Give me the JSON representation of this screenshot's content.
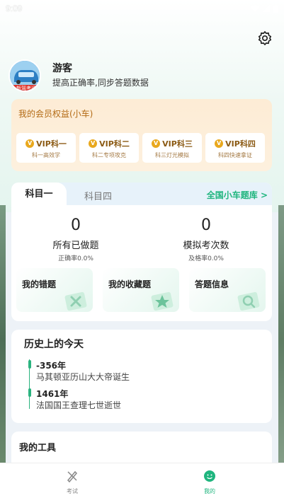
{
  "status": {
    "time": "9:09"
  },
  "profile": {
    "name": "游客",
    "subtitle": "提高正确率,同步答题数据",
    "avatar_badge": "新驾考通"
  },
  "vip": {
    "title": "我的会员权益(小车)",
    "items": [
      {
        "label": "VIP科一",
        "desc": "科一高效学"
      },
      {
        "label": "VIP科二",
        "desc": "科二专项攻克"
      },
      {
        "label": "VIP科三",
        "desc": "科三灯光模拟"
      },
      {
        "label": "VIP科四",
        "desc": "科四快速拿证"
      }
    ]
  },
  "exam": {
    "tabs": [
      "科目一",
      "科目四"
    ],
    "bank_link": "全国小车题库 >",
    "stats": [
      {
        "value": "0",
        "label": "所有已做题",
        "sub": "正确率0.0%"
      },
      {
        "value": "0",
        "label": "模拟考次数",
        "sub": "及格率0.0%"
      }
    ],
    "functions": [
      "我的错题",
      "我的收藏题",
      "答题信息"
    ]
  },
  "history": {
    "title": "历史上的今天",
    "events": [
      {
        "year": "-356年",
        "text": "马其顿亚历山大大帝诞生"
      },
      {
        "year": "1461年",
        "text": "法国国王查理七世逝世"
      }
    ]
  },
  "tools": {
    "title": "我的工具"
  },
  "nav": {
    "items": [
      {
        "label": "考试",
        "active": false
      },
      {
        "label": "我的",
        "active": true
      }
    ]
  },
  "colors": {
    "accent": "#1fb57e",
    "vip_text": "#b36a14",
    "vip_bg": "#fdecd5"
  }
}
